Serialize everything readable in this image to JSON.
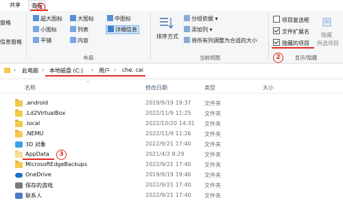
{
  "tabs": {
    "share": "共享",
    "view": "查看"
  },
  "ribbon": {
    "pane": {
      "left_label": "窗格",
      "preview_label": "信息窗格"
    },
    "layout": {
      "extra_large": "超大图标",
      "large": "大图标",
      "medium": "中图标",
      "small": "小图标",
      "list": "列表",
      "details": "详细信息",
      "tiles": "平铺",
      "content": "内容",
      "group_label": "布局"
    },
    "current_view": {
      "sort_by": "排序方式",
      "group_by": "分组依据",
      "add_columns": "添加列",
      "size_all_columns": "将所有列调整为合适的大小",
      "group_label": "当前视图"
    },
    "show_hide": {
      "item_checkboxes": "项目复选框",
      "file_extensions": "文件扩展名",
      "hidden_items": "隐藏的项目",
      "hide_selected": "隐藏",
      "selected_items": "所选项目",
      "group_label": "显示/隐藏",
      "item_checkboxes_checked": false,
      "file_extensions_checked": true,
      "hidden_items_checked": true
    }
  },
  "address": {
    "this_pc": "此电脑",
    "local_disk": "本地磁盘 (C:)",
    "users": "用户",
    "user": "che. cai"
  },
  "columns": {
    "name": "名称",
    "date": "修改日期",
    "type": "类型",
    "size": "大小"
  },
  "files": [
    {
      "name": ".android",
      "date": "2019/9/19 19:37",
      "type": "文件夹",
      "icon": "folder-icon"
    },
    {
      "name": ".Ld2VirtualBox",
      "date": "2022/11/9 11:25",
      "type": "文件夹",
      "icon": "folder-icon"
    },
    {
      "name": ".local",
      "date": "2022/10/20 14:31",
      "type": "文件夹",
      "icon": "folder-icon"
    },
    {
      "name": ".NEMU",
      "date": "2022/11/9 11:26",
      "type": "文件夹",
      "icon": "folder-icon"
    },
    {
      "name": "3D 对象",
      "date": "2022/9/21 17:40",
      "type": "文件夹",
      "icon": "3d-objects-icon"
    },
    {
      "name": "AppData",
      "date": "2021/4/2 8:29",
      "type": "文件夹",
      "icon": "folder-icon"
    },
    {
      "name": "MicrosoftEdgeBackups",
      "date": "2022/9/21 17:40",
      "type": "文件夹",
      "icon": "folder-icon"
    },
    {
      "name": "OneDrive",
      "date": "2019/9/19 19:46",
      "type": "文件夹",
      "icon": "onedrive-icon"
    },
    {
      "name": "保存的游戏",
      "date": "2022/9/21 17:40",
      "type": "文件夹",
      "icon": "saved-games-icon"
    },
    {
      "name": "联系人",
      "date": "2022/9/21 17:40",
      "type": "文件夹",
      "icon": "contacts-icon"
    }
  ],
  "annotations": {
    "step1": "1",
    "step2": "2",
    "step3": "3"
  },
  "colors": {
    "annotation_red": "#e0281f",
    "folder_yellow": "#f3c94f",
    "accent_blue": "#1a73c9"
  }
}
